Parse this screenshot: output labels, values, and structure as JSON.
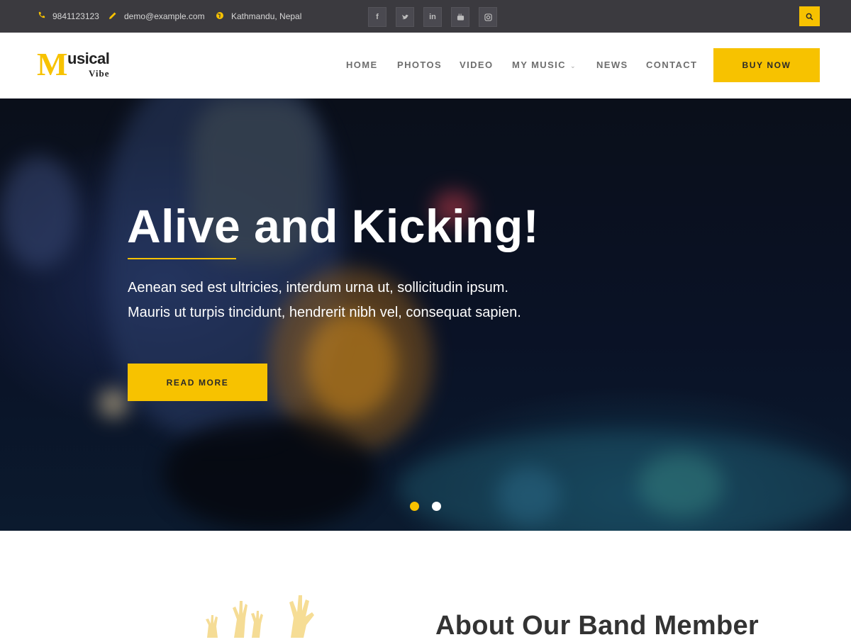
{
  "topbar": {
    "phone": "9841123123",
    "email": "demo@example.com",
    "location": "Kathmandu, Nepal",
    "social": [
      "f",
      "t",
      "in",
      "yt",
      "ig"
    ],
    "phone_icon": "phone-icon",
    "email_icon": "pencil-icon",
    "location_icon": "globe-icon",
    "search_icon": "search-icon"
  },
  "logo": {
    "letter": "M",
    "word": "usical",
    "sub": "Vibe"
  },
  "nav": {
    "items": [
      "HOME",
      "PHOTOS",
      "VIDEO",
      "MY MUSIC",
      "NEWS",
      "CONTACT"
    ],
    "buy_label": "BUY NOW"
  },
  "hero": {
    "title": "Alive and Kicking!",
    "line1": "Aenean sed est ultricies, interdum urna ut, sollicitudin ipsum.",
    "line2": "Mauris ut turpis tincidunt, hendrerit nibh vel, consequat sapien.",
    "button": "READ MORE",
    "active_slide": 1,
    "slide_count": 2
  },
  "about": {
    "title": "About Our Band Member"
  },
  "colors": {
    "accent": "#f7c200",
    "topbar": "#3b3a3f",
    "nav_text": "#6e6e6e"
  }
}
